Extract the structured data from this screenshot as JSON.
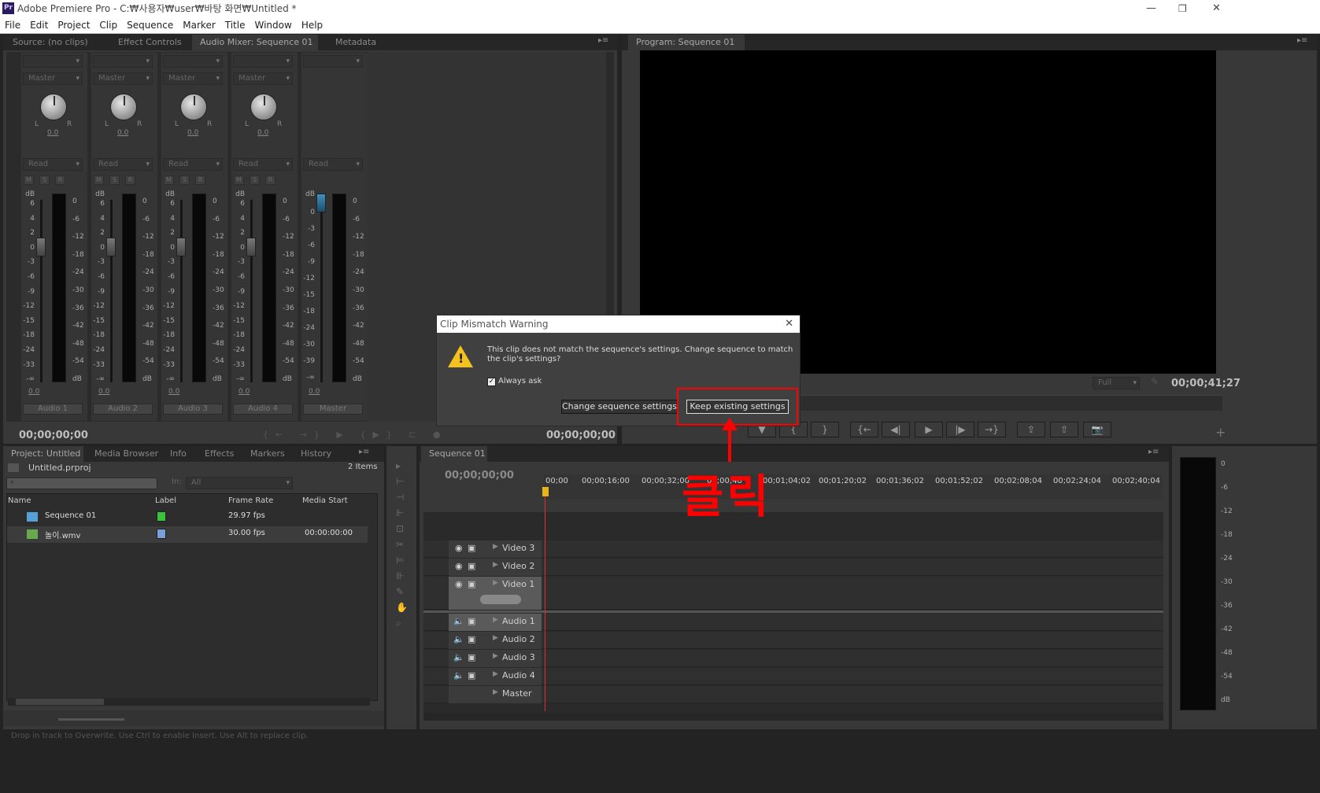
{
  "titlebar": {
    "app_icon": "Pr",
    "title": "Adobe Premiere Pro - C:₩사용자₩user₩바탕 화면₩Untitled *"
  },
  "menu": [
    "File",
    "Edit",
    "Project",
    "Clip",
    "Sequence",
    "Marker",
    "Title",
    "Window",
    "Help"
  ],
  "source_panel": {
    "tabs": [
      "Source: (no clips)",
      "Effect Controls",
      "Audio Mixer: Sequence 01",
      "Metadata"
    ],
    "channels": [
      {
        "name": "Audio 1",
        "send": "Master",
        "auto": "Read",
        "pan": "0.0",
        "vol": "0.0"
      },
      {
        "name": "Audio 2",
        "send": "Master",
        "auto": "Read",
        "pan": "0.0",
        "vol": "0.0"
      },
      {
        "name": "Audio 3",
        "send": "Master",
        "auto": "Read",
        "pan": "0.0",
        "vol": "0.0"
      },
      {
        "name": "Audio 4",
        "send": "Master",
        "auto": "Read",
        "pan": "0.0",
        "vol": "0.0"
      },
      {
        "name": "Master",
        "send": "",
        "auto": "Read",
        "pan": "",
        "vol": "0.0"
      }
    ],
    "fader_scale": [
      "dB",
      "6",
      "4",
      "2",
      "0",
      "-3",
      "-6",
      "-9",
      "-12",
      "-15",
      "-18",
      "-24",
      "-33",
      "-∞"
    ],
    "master_fader_scale": [
      "dB",
      "0",
      "-3",
      "-6",
      "-9",
      "-12",
      "-15",
      "-18",
      "-24",
      "-30",
      "-39",
      "-∞"
    ],
    "meter_scale": [
      "0",
      "-6",
      "-12",
      "-18",
      "-24",
      "-30",
      "-36",
      "-42",
      "-48",
      "-54",
      "dB"
    ],
    "pan_lr": [
      "L",
      "R"
    ],
    "msr": [
      "M",
      "S",
      "R"
    ],
    "tc_left": "00;00;00;00",
    "tc_right": "00;00;00;00"
  },
  "program": {
    "tab": "Program: Sequence 01",
    "zoom": "Full",
    "timecode": "00;00;41;27"
  },
  "project": {
    "tabs": [
      "Project: Untitled",
      "Media Browser",
      "Info",
      "Effects",
      "Markers",
      "History"
    ],
    "file": "Untitled.prproj",
    "count": "2 Items",
    "search_placeholder": "",
    "in_label": "In:",
    "in_value": "All",
    "columns": [
      "Name",
      "Label",
      "Frame Rate",
      "Media Start"
    ],
    "rows": [
      {
        "name": "Sequence 01",
        "label_color": "#3cc13c",
        "fps": "29.97 fps",
        "start": ""
      },
      {
        "name": "놀이.wmv",
        "label_color": "#7a9ed8",
        "fps": "30.00 fps",
        "start": "00:00:00:00"
      }
    ]
  },
  "timeline": {
    "tab": "Sequence 01",
    "timecode": "00;00;00;00",
    "ruler": [
      "00;00",
      "00;00;16;00",
      "00;00;32;00",
      "00;00;48",
      "00;01;04;02",
      "00;01;20;02",
      "00;01;36;02",
      "00;01;52;02",
      "00;02;08;04",
      "00;02;24;04",
      "00;02;40;04"
    ],
    "video_tracks": [
      "Video 3",
      "Video 2",
      "Video 1"
    ],
    "audio_tracks": [
      "Audio 1",
      "Audio 2",
      "Audio 3",
      "Audio 4"
    ],
    "master": "Master",
    "right_meter": [
      "0",
      "-6",
      "-12",
      "-18",
      "-24",
      "-30",
      "-36",
      "-42",
      "-48",
      "-54",
      "dB"
    ]
  },
  "dialog": {
    "title": "Clip Mismatch Warning",
    "message": "This clip does not match the sequence's settings. Change sequence to match the clip's settings?",
    "checkbox": "Always ask",
    "checked": true,
    "btn_change": "Change sequence settings",
    "btn_keep": "Keep existing settings"
  },
  "annotation": {
    "text": "클릭",
    "color": "#ff0000"
  },
  "statusbar": "Drop in track to Overwrite. Use Ctrl to enable Insert. Use Alt to replace clip."
}
